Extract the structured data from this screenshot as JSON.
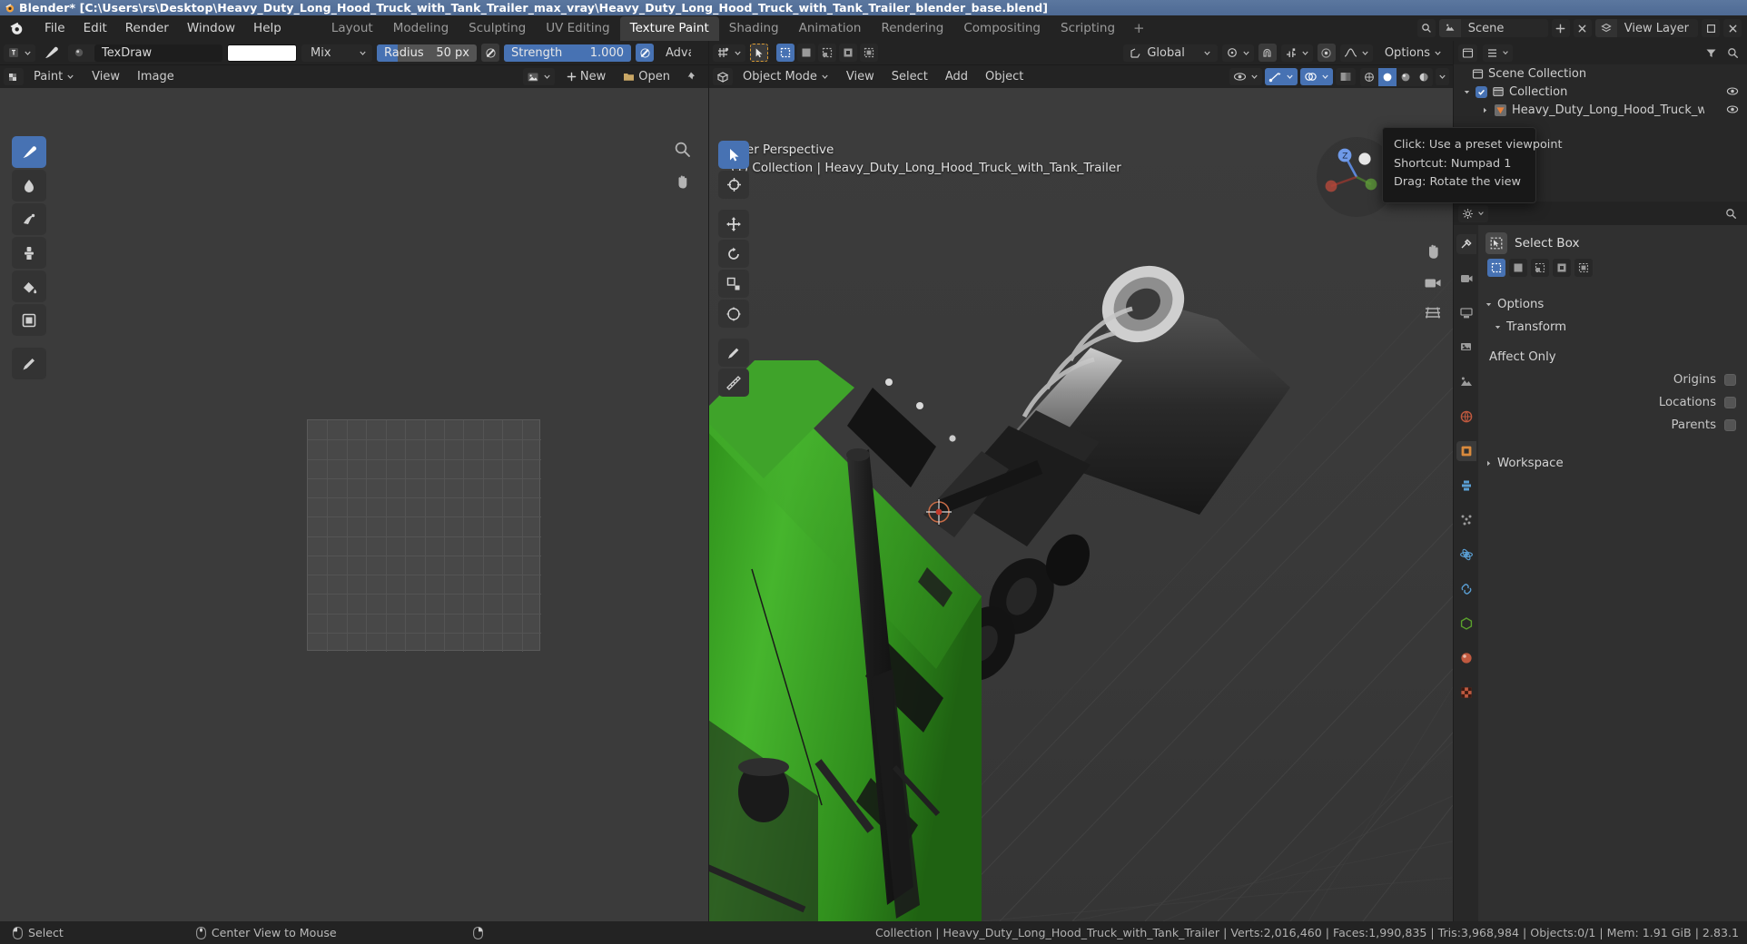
{
  "window": {
    "title": "Blender* [C:\\Users\\rs\\Desktop\\Heavy_Duty_Long_Hood_Truck_with_Tank_Trailer_max_vray\\Heavy_Duty_Long_Hood_Truck_with_Tank_Trailer_blender_base.blend]",
    "icon": "blender-logo-icon"
  },
  "topbar": {
    "menus": [
      "File",
      "Edit",
      "Render",
      "Window",
      "Help"
    ],
    "workspace_tabs": [
      {
        "label": "Layout",
        "active": false
      },
      {
        "label": "Modeling",
        "active": false
      },
      {
        "label": "Sculpting",
        "active": false
      },
      {
        "label": "UV Editing",
        "active": false
      },
      {
        "label": "Texture Paint",
        "active": true
      },
      {
        "label": "Shading",
        "active": false
      },
      {
        "label": "Animation",
        "active": false
      },
      {
        "label": "Rendering",
        "active": false
      },
      {
        "label": "Compositing",
        "active": false
      },
      {
        "label": "Scripting",
        "active": false
      },
      {
        "label": "+",
        "active": false
      }
    ],
    "scene_name": "Scene",
    "view_layer_name": "View Layer"
  },
  "image_editor": {
    "brush_row": {
      "brush_name": "TexDraw",
      "color": "#ffffff",
      "blend_mode": "Mix",
      "radius_label": "Radius",
      "radius_value": "50 px",
      "strength_label": "Strength",
      "strength_value": "1.000",
      "advanced_label": "Adva"
    },
    "menu_row": {
      "mode": "Paint",
      "menus": [
        "View",
        "Image"
      ],
      "new_button": "New",
      "open_button": "Open"
    },
    "tools": [
      {
        "name": "draw-brush-tool",
        "active": true
      },
      {
        "name": "soften-tool",
        "active": false
      },
      {
        "name": "smear-tool",
        "active": false
      },
      {
        "name": "clone-tool",
        "active": false
      },
      {
        "name": "fill-tool",
        "active": false
      },
      {
        "name": "mask-tool",
        "active": false
      },
      {
        "name": "annotate-tool",
        "active": false
      }
    ]
  },
  "viewport": {
    "header": {
      "mode": "Object Mode",
      "menus": [
        "View",
        "Select",
        "Add",
        "Object"
      ],
      "transform_orientation": "Global",
      "options_label": "Options"
    },
    "overlay": {
      "perspective": "User Perspective",
      "collection_info": "(1) Collection | Heavy_Duty_Long_Hood_Truck_with_Tank_Trailer"
    },
    "tooltip": {
      "line1": "Click: Use a preset viewpoint",
      "line2": "Shortcut: Numpad 1",
      "line3": "Drag: Rotate the view"
    },
    "model_colors": {
      "cab_green": "#3fa32a",
      "cab_green_dark": "#2d7a1e",
      "chassis_dark": "#1e1e1e",
      "tank_grey": "#b9b9b9"
    }
  },
  "outliner": {
    "scene_collection": "Scene Collection",
    "collection": "Collection",
    "object": "Heavy_Duty_Long_Hood_Truck_with_Tank_T"
  },
  "properties": {
    "active_tool_title": "Select Box",
    "sections": [
      {
        "label": "Options",
        "expanded": true
      },
      {
        "label": "Transform",
        "expanded": true
      }
    ],
    "affect_only_label": "Affect Only",
    "affect_only_items": [
      {
        "label": "Origins",
        "checked": false
      },
      {
        "label": "Locations",
        "checked": false
      },
      {
        "label": "Parents",
        "checked": false
      }
    ],
    "workspace_label": "Workspace"
  },
  "statusbar": {
    "left_items": [
      {
        "label": "Select",
        "icon": "mouse-left-icon"
      },
      {
        "label": "Center View to Mouse",
        "icon": "mouse-middle-icon"
      },
      {
        "label": "",
        "icon": "mouse-right-icon"
      }
    ],
    "stats": "Collection | Heavy_Duty_Long_Hood_Truck_with_Tank_Trailer | Verts:2,016,460 | Faces:1,990,835 | Tris:3,968,984 | Objects:0/1 | Mem: 1.91 GiB | 2.83.1"
  }
}
